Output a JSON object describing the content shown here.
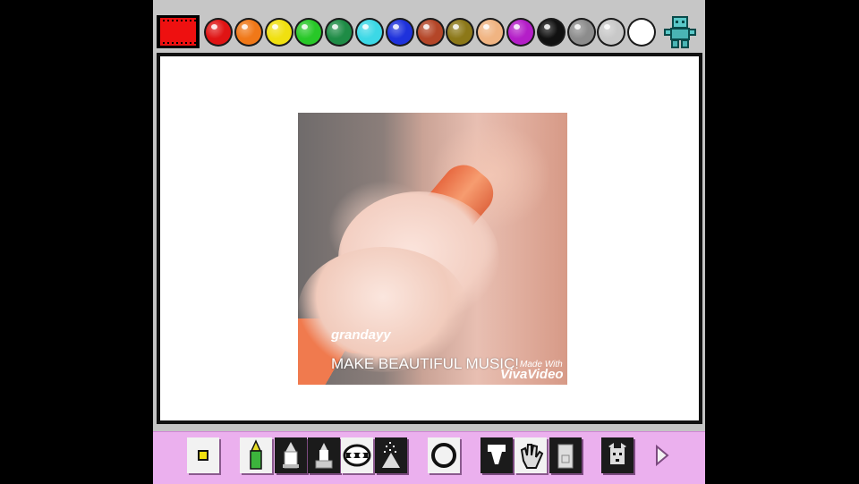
{
  "palette": {
    "current_color": "#ee1010",
    "swatches": [
      {
        "name": "red",
        "hex": "#e01414"
      },
      {
        "name": "orange",
        "hex": "#f07818"
      },
      {
        "name": "yellow",
        "hex": "#f0e010"
      },
      {
        "name": "green",
        "hex": "#28c828"
      },
      {
        "name": "dark-green",
        "hex": "#1e8c46"
      },
      {
        "name": "cyan",
        "hex": "#3cd8e6"
      },
      {
        "name": "blue",
        "hex": "#1e32dc"
      },
      {
        "name": "brown",
        "hex": "#b44628"
      },
      {
        "name": "olive",
        "hex": "#8c7818"
      },
      {
        "name": "peach",
        "hex": "#f0b482"
      },
      {
        "name": "purple",
        "hex": "#b41ec8"
      },
      {
        "name": "black",
        "hex": "#111111"
      },
      {
        "name": "gray",
        "hex": "#8c8c8c"
      },
      {
        "name": "light-gray",
        "hex": "#c8c8c8"
      },
      {
        "name": "white",
        "hex": "#ffffff"
      }
    ],
    "mascot_icon": "robot-mascot-icon"
  },
  "canvas": {
    "image": {
      "watermark_user": "grandayy",
      "caption": "MAKE BEAUTIFUL MUSIC!",
      "made_with": "Made With",
      "brand": "VivaVideo"
    }
  },
  "toolbar": {
    "accent": "#ebb0ee",
    "tools": [
      {
        "name": "brush-size-icon"
      },
      {
        "name": "crayon-icon"
      },
      {
        "name": "thick-pencil-icon"
      },
      {
        "name": "thin-pencil-icon"
      },
      {
        "name": "stamp-icon"
      },
      {
        "name": "spray-icon"
      },
      {
        "name": "circle-shape-icon"
      },
      {
        "name": "paint-bucket-icon"
      },
      {
        "name": "hand-icon"
      },
      {
        "name": "eraser-icon"
      },
      {
        "name": "dog-undo-icon"
      },
      {
        "name": "next-arrow-icon"
      }
    ]
  }
}
